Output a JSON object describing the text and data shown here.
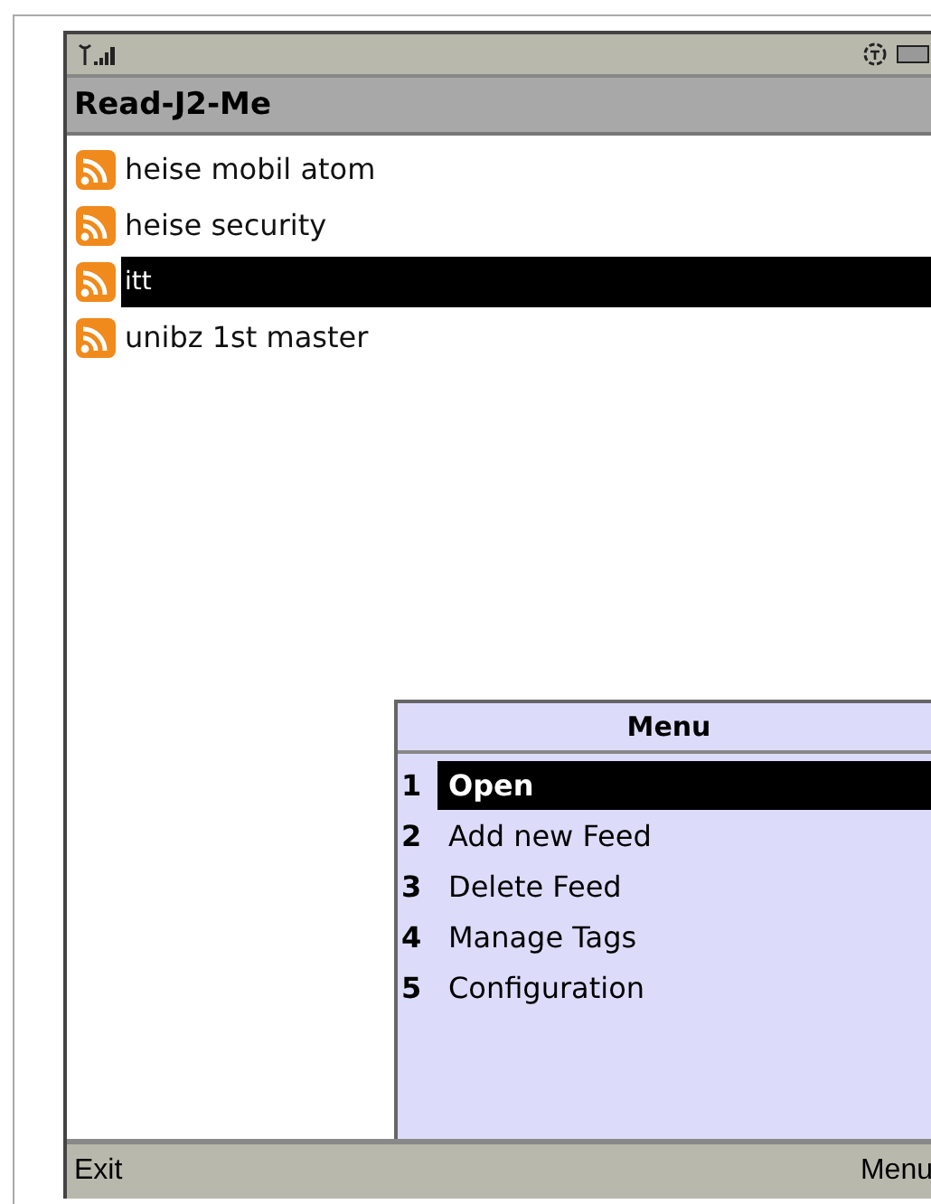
{
  "app_title": "Read-J2-Me",
  "feeds": [
    {
      "label": "heise mobil atom",
      "selected": false
    },
    {
      "label": "heise security",
      "selected": false
    },
    {
      "label": "itt",
      "selected": true
    },
    {
      "label": "unibz 1st master",
      "selected": false
    }
  ],
  "menu": {
    "title": "Menu",
    "items": [
      {
        "number": "1",
        "label": "Open",
        "selected": true
      },
      {
        "number": "2",
        "label": "Add new Feed",
        "selected": false
      },
      {
        "number": "3",
        "label": "Delete Feed",
        "selected": false
      },
      {
        "number": "4",
        "label": "Manage Tags",
        "selected": false
      },
      {
        "number": "5",
        "label": "Configuration",
        "selected": false
      }
    ]
  },
  "softkeys": {
    "left": "Exit",
    "right": "Menu"
  }
}
